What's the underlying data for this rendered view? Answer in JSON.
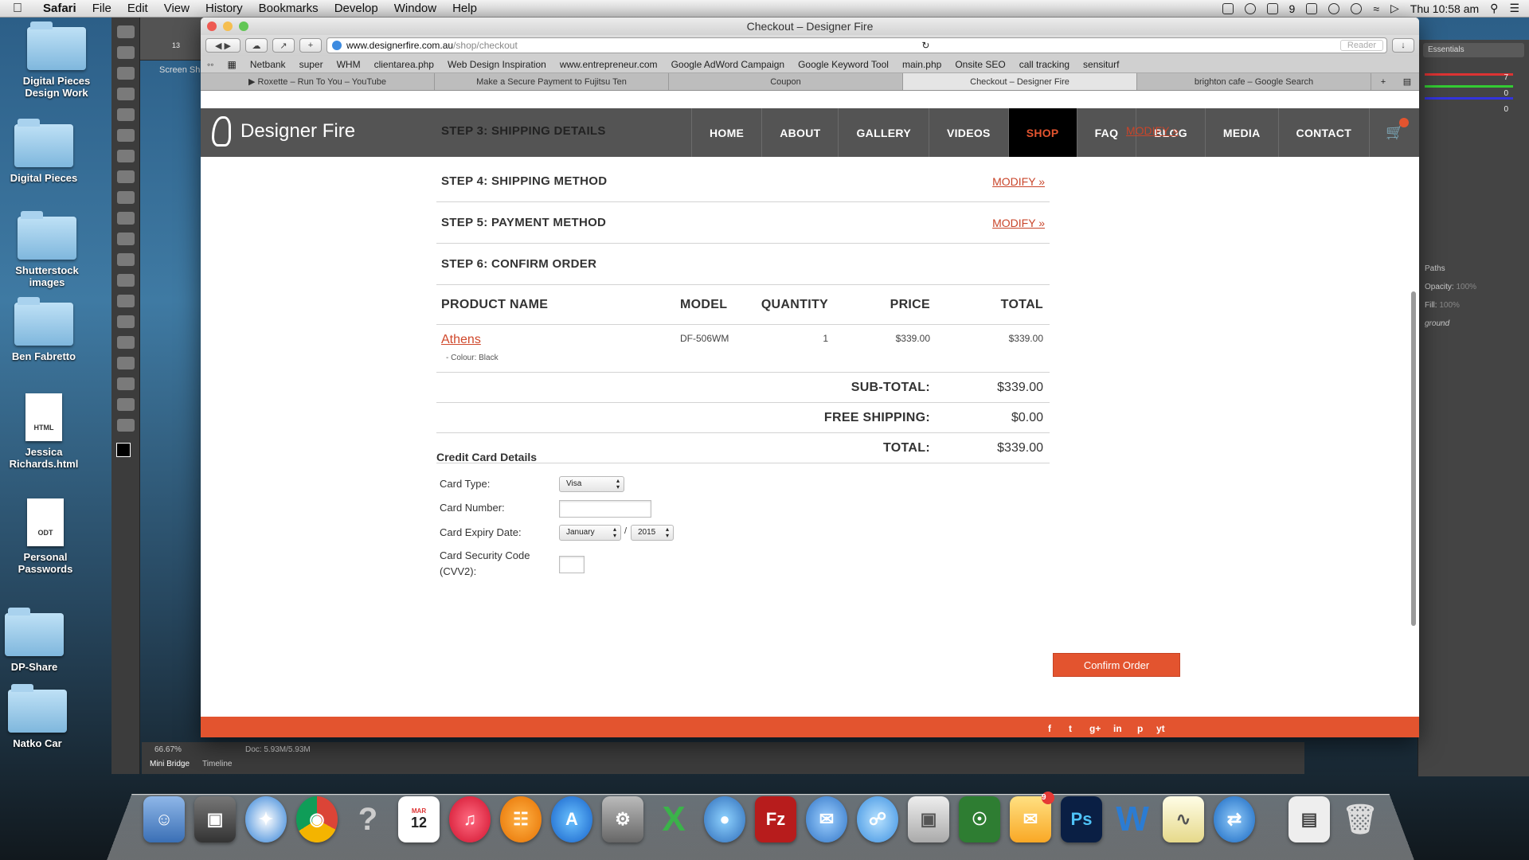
{
  "menubar": {
    "app": "Safari",
    "items": [
      "File",
      "Edit",
      "View",
      "History",
      "Bookmarks",
      "Develop",
      "Window",
      "Help"
    ],
    "status_9": "9",
    "clock": "Thu 10:58 am"
  },
  "desktop": {
    "icons": [
      {
        "label": "Digital Pieces Design Work",
        "kind": "folder"
      },
      {
        "label": "Digital Pieces",
        "kind": "folder"
      },
      {
        "label": "Shutterstock images",
        "kind": "folder"
      },
      {
        "label": "Ben Fabretto",
        "kind": "folder"
      },
      {
        "label": "Jessica Richards.html",
        "kind": "doc",
        "badge": "HTML"
      },
      {
        "label": "Personal Passwords",
        "kind": "doc",
        "badge": "ODT"
      },
      {
        "label": "DP-Share",
        "kind": "folder"
      },
      {
        "label": "Natko Car",
        "kind": "folder"
      }
    ]
  },
  "photoshop": {
    "essentials": "Essentials",
    "paths_tab": "Paths",
    "opacity_label": "Opacity:",
    "fill_label": "Fill:",
    "opacity_value": "100%",
    "layer_name": "ground",
    "zoom": "66.67%",
    "doc_size": "Doc: 5.93M/5.93M",
    "tabs": [
      "Mini Bridge",
      "Timeline"
    ],
    "color_values": [
      "7",
      "0",
      "0"
    ],
    "brush_size": "13",
    "screen_tab": "Screen Sh"
  },
  "browser": {
    "window_title": "Checkout – Designer Fire",
    "url_host": "www.designerfire.com.au",
    "url_path": "/shop/checkout",
    "reader": "Reader",
    "bookmarks": [
      "Netbank",
      "super",
      "WHM",
      "clientarea.php",
      "Web Design Inspiration",
      "www.entrepreneur.com",
      "Google AdWord Campaign",
      "Google Keyword Tool",
      "main.php",
      "Onsite SEO",
      "call tracking",
      "sensiturf"
    ],
    "tabs": [
      "▶ Roxette – Run To You – YouTube",
      "Make a Secure Payment to Fujitsu Ten",
      "Coupon",
      "Checkout – Designer Fire",
      "brighton cafe – Google Search"
    ],
    "active_tab": 3
  },
  "site": {
    "logo": "Designer Fire",
    "nav": [
      "HOME",
      "ABOUT",
      "GALLERY",
      "VIDEOS",
      "SHOP",
      "FAQ",
      "BLOG",
      "MEDIA",
      "CONTACT"
    ],
    "active_nav": "SHOP",
    "cart_count": "1",
    "step3": "STEP 3: SHIPPING DETAILS",
    "modify_label": "MODIFY »",
    "steps": [
      {
        "label": "STEP 4: SHIPPING METHOD",
        "modify": "MODIFY »"
      },
      {
        "label": "STEP 5: PAYMENT METHOD",
        "modify": "MODIFY »"
      },
      {
        "label": "STEP 6: CONFIRM ORDER",
        "modify": ""
      }
    ],
    "table": {
      "headers": [
        "PRODUCT NAME",
        "MODEL",
        "QUANTITY",
        "PRICE",
        "TOTAL"
      ],
      "rows": [
        {
          "name": "Athens",
          "option": "- Colour: Black",
          "model": "DF-506WM",
          "quantity": "1",
          "price": "$339.00",
          "total": "$339.00"
        }
      ],
      "totals": [
        {
          "label": "SUB-TOTAL:",
          "value": "$339.00"
        },
        {
          "label": "FREE SHIPPING:",
          "value": "$0.00"
        },
        {
          "label": "TOTAL:",
          "value": "$339.00"
        }
      ]
    },
    "credit_card": {
      "title": "Credit Card Details",
      "card_type_label": "Card Type:",
      "card_type_value": "Visa",
      "card_number_label": "Card Number:",
      "card_number_value": "",
      "expiry_label": "Card Expiry Date:",
      "expiry_month": "January",
      "expiry_sep": "/",
      "expiry_year": "2015",
      "cvv_label_1": "Card Security Code",
      "cvv_label_2": "(CVV2):",
      "cvv_value": ""
    },
    "confirm_button": "Confirm Order",
    "social": [
      "f",
      "t",
      "g+",
      "in",
      "p",
      "yt"
    ]
  },
  "dock": {
    "calendar_month": "MAR",
    "calendar_day": "12",
    "mail_badge": "9"
  }
}
